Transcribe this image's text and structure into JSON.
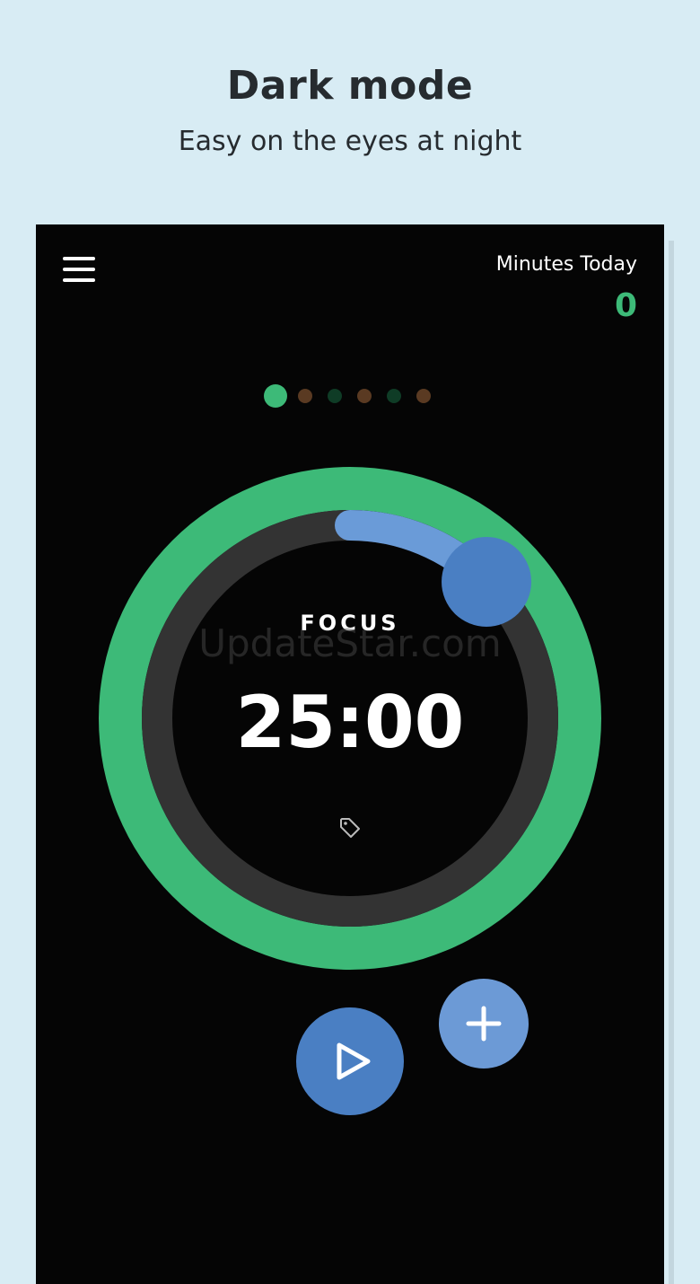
{
  "promo": {
    "title": "Dark mode",
    "subtitle": "Easy on the eyes at night"
  },
  "header": {
    "menu_icon": "hamburger-menu-icon",
    "minutes_label": "Minutes Today",
    "minutes_value": "0"
  },
  "session_indicator": {
    "total": 6,
    "current": 1,
    "colors": {
      "active_focus": "#3dba78",
      "focus": "#0f3c26",
      "break": "#5a3a22"
    }
  },
  "timer": {
    "mode_label": "FOCUS",
    "time": "25:00",
    "progress_fraction": 0.125,
    "tag_icon": "tag-icon"
  },
  "watermark": "UpdateStar.com",
  "controls": {
    "play_icon": "play-icon",
    "add_icon": "plus-icon"
  },
  "colors": {
    "background": "#d8ecf4",
    "phone_bg": "#050505",
    "ring_outer": "#3dba78",
    "ring_track": "#333333",
    "arc": "#6a9bd8",
    "knob": "#4a7fc3",
    "play_button": "#4a7fc3",
    "add_button": "#6c9ad6"
  }
}
